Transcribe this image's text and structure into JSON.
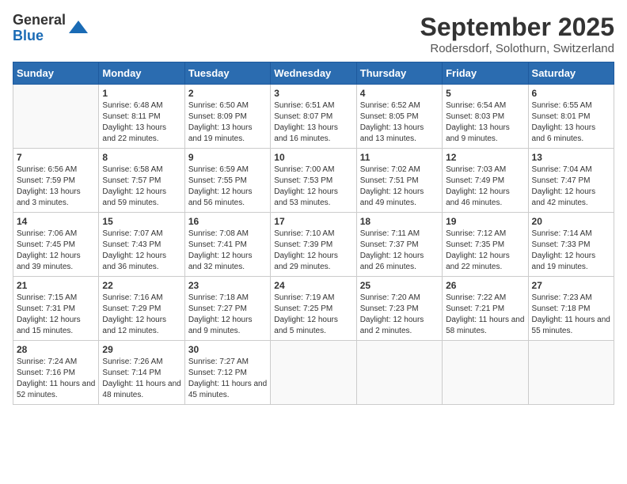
{
  "logo": {
    "general": "General",
    "blue": "Blue"
  },
  "header": {
    "month": "September 2025",
    "location": "Rodersdorf, Solothurn, Switzerland"
  },
  "days": [
    "Sunday",
    "Monday",
    "Tuesday",
    "Wednesday",
    "Thursday",
    "Friday",
    "Saturday"
  ],
  "weeks": [
    [
      {
        "date": "",
        "sunrise": "",
        "sunset": "",
        "daylight": ""
      },
      {
        "date": "1",
        "sunrise": "Sunrise: 6:48 AM",
        "sunset": "Sunset: 8:11 PM",
        "daylight": "Daylight: 13 hours and 22 minutes."
      },
      {
        "date": "2",
        "sunrise": "Sunrise: 6:50 AM",
        "sunset": "Sunset: 8:09 PM",
        "daylight": "Daylight: 13 hours and 19 minutes."
      },
      {
        "date": "3",
        "sunrise": "Sunrise: 6:51 AM",
        "sunset": "Sunset: 8:07 PM",
        "daylight": "Daylight: 13 hours and 16 minutes."
      },
      {
        "date": "4",
        "sunrise": "Sunrise: 6:52 AM",
        "sunset": "Sunset: 8:05 PM",
        "daylight": "Daylight: 13 hours and 13 minutes."
      },
      {
        "date": "5",
        "sunrise": "Sunrise: 6:54 AM",
        "sunset": "Sunset: 8:03 PM",
        "daylight": "Daylight: 13 hours and 9 minutes."
      },
      {
        "date": "6",
        "sunrise": "Sunrise: 6:55 AM",
        "sunset": "Sunset: 8:01 PM",
        "daylight": "Daylight: 13 hours and 6 minutes."
      }
    ],
    [
      {
        "date": "7",
        "sunrise": "Sunrise: 6:56 AM",
        "sunset": "Sunset: 7:59 PM",
        "daylight": "Daylight: 13 hours and 3 minutes."
      },
      {
        "date": "8",
        "sunrise": "Sunrise: 6:58 AM",
        "sunset": "Sunset: 7:57 PM",
        "daylight": "Daylight: 12 hours and 59 minutes."
      },
      {
        "date": "9",
        "sunrise": "Sunrise: 6:59 AM",
        "sunset": "Sunset: 7:55 PM",
        "daylight": "Daylight: 12 hours and 56 minutes."
      },
      {
        "date": "10",
        "sunrise": "Sunrise: 7:00 AM",
        "sunset": "Sunset: 7:53 PM",
        "daylight": "Daylight: 12 hours and 53 minutes."
      },
      {
        "date": "11",
        "sunrise": "Sunrise: 7:02 AM",
        "sunset": "Sunset: 7:51 PM",
        "daylight": "Daylight: 12 hours and 49 minutes."
      },
      {
        "date": "12",
        "sunrise": "Sunrise: 7:03 AM",
        "sunset": "Sunset: 7:49 PM",
        "daylight": "Daylight: 12 hours and 46 minutes."
      },
      {
        "date": "13",
        "sunrise": "Sunrise: 7:04 AM",
        "sunset": "Sunset: 7:47 PM",
        "daylight": "Daylight: 12 hours and 42 minutes."
      }
    ],
    [
      {
        "date": "14",
        "sunrise": "Sunrise: 7:06 AM",
        "sunset": "Sunset: 7:45 PM",
        "daylight": "Daylight: 12 hours and 39 minutes."
      },
      {
        "date": "15",
        "sunrise": "Sunrise: 7:07 AM",
        "sunset": "Sunset: 7:43 PM",
        "daylight": "Daylight: 12 hours and 36 minutes."
      },
      {
        "date": "16",
        "sunrise": "Sunrise: 7:08 AM",
        "sunset": "Sunset: 7:41 PM",
        "daylight": "Daylight: 12 hours and 32 minutes."
      },
      {
        "date": "17",
        "sunrise": "Sunrise: 7:10 AM",
        "sunset": "Sunset: 7:39 PM",
        "daylight": "Daylight: 12 hours and 29 minutes."
      },
      {
        "date": "18",
        "sunrise": "Sunrise: 7:11 AM",
        "sunset": "Sunset: 7:37 PM",
        "daylight": "Daylight: 12 hours and 26 minutes."
      },
      {
        "date": "19",
        "sunrise": "Sunrise: 7:12 AM",
        "sunset": "Sunset: 7:35 PM",
        "daylight": "Daylight: 12 hours and 22 minutes."
      },
      {
        "date": "20",
        "sunrise": "Sunrise: 7:14 AM",
        "sunset": "Sunset: 7:33 PM",
        "daylight": "Daylight: 12 hours and 19 minutes."
      }
    ],
    [
      {
        "date": "21",
        "sunrise": "Sunrise: 7:15 AM",
        "sunset": "Sunset: 7:31 PM",
        "daylight": "Daylight: 12 hours and 15 minutes."
      },
      {
        "date": "22",
        "sunrise": "Sunrise: 7:16 AM",
        "sunset": "Sunset: 7:29 PM",
        "daylight": "Daylight: 12 hours and 12 minutes."
      },
      {
        "date": "23",
        "sunrise": "Sunrise: 7:18 AM",
        "sunset": "Sunset: 7:27 PM",
        "daylight": "Daylight: 12 hours and 9 minutes."
      },
      {
        "date": "24",
        "sunrise": "Sunrise: 7:19 AM",
        "sunset": "Sunset: 7:25 PM",
        "daylight": "Daylight: 12 hours and 5 minutes."
      },
      {
        "date": "25",
        "sunrise": "Sunrise: 7:20 AM",
        "sunset": "Sunset: 7:23 PM",
        "daylight": "Daylight: 12 hours and 2 minutes."
      },
      {
        "date": "26",
        "sunrise": "Sunrise: 7:22 AM",
        "sunset": "Sunset: 7:21 PM",
        "daylight": "Daylight: 11 hours and 58 minutes."
      },
      {
        "date": "27",
        "sunrise": "Sunrise: 7:23 AM",
        "sunset": "Sunset: 7:18 PM",
        "daylight": "Daylight: 11 hours and 55 minutes."
      }
    ],
    [
      {
        "date": "28",
        "sunrise": "Sunrise: 7:24 AM",
        "sunset": "Sunset: 7:16 PM",
        "daylight": "Daylight: 11 hours and 52 minutes."
      },
      {
        "date": "29",
        "sunrise": "Sunrise: 7:26 AM",
        "sunset": "Sunset: 7:14 PM",
        "daylight": "Daylight: 11 hours and 48 minutes."
      },
      {
        "date": "30",
        "sunrise": "Sunrise: 7:27 AM",
        "sunset": "Sunset: 7:12 PM",
        "daylight": "Daylight: 11 hours and 45 minutes."
      },
      {
        "date": "",
        "sunrise": "",
        "sunset": "",
        "daylight": ""
      },
      {
        "date": "",
        "sunrise": "",
        "sunset": "",
        "daylight": ""
      },
      {
        "date": "",
        "sunrise": "",
        "sunset": "",
        "daylight": ""
      },
      {
        "date": "",
        "sunrise": "",
        "sunset": "",
        "daylight": ""
      }
    ]
  ]
}
